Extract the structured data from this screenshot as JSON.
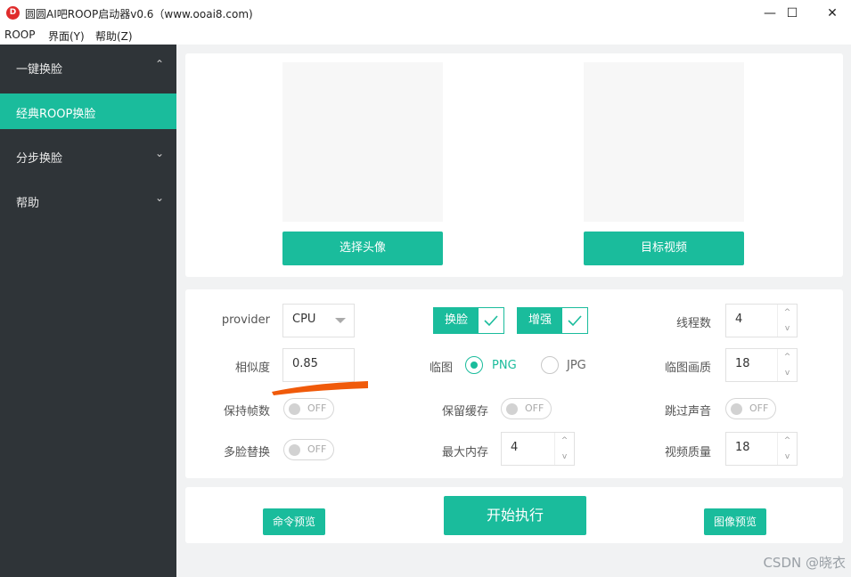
{
  "window": {
    "title": "圆圆AI吧ROOP启动器v0.6（www.ooai8.com)",
    "app_icon_glyph": "D",
    "controls": {
      "minimize": "—",
      "maximize": "☐",
      "close": "✕"
    }
  },
  "menubar": [
    "ROOP",
    "界面(Y)",
    "帮助(Z)"
  ],
  "sidebar": {
    "items": [
      {
        "label": "一键换脸",
        "chevron": "⌃"
      },
      {
        "label": "经典ROOP换脸",
        "chevron": ""
      },
      {
        "label": "分步换脸",
        "chevron": "⌄"
      },
      {
        "label": "帮助",
        "chevron": "⌄"
      }
    ],
    "active_index": 1
  },
  "images": {
    "select_face_button": "选择头像",
    "target_video_button": "目标视频"
  },
  "settings": {
    "provider": {
      "label": "provider",
      "value": "CPU"
    },
    "swap_face": {
      "label": "换脸",
      "checked": true
    },
    "enhance": {
      "label": "增强",
      "checked": true
    },
    "threads": {
      "label": "线程数",
      "value": "4"
    },
    "similarity": {
      "label": "相似度",
      "value": "0.85"
    },
    "temp_frame_format": {
      "label": "临图",
      "options": [
        "PNG",
        "JPG"
      ],
      "selected": "PNG"
    },
    "temp_frame_quality": {
      "label": "临图画质",
      "value": "18"
    },
    "keep_fps": {
      "label": "保持帧数",
      "state": "OFF"
    },
    "keep_temp": {
      "label": "保留缓存",
      "state": "OFF"
    },
    "skip_audio": {
      "label": "跳过声音",
      "state": "OFF"
    },
    "many_faces": {
      "label": "多脸替换",
      "state": "OFF"
    },
    "max_memory": {
      "label": "最大内存",
      "value": "4"
    },
    "video_quality": {
      "label": "视频质量",
      "value": "18"
    }
  },
  "actions": {
    "command_preview": "命令预览",
    "start": "开始执行",
    "image_preview": "图像预览"
  },
  "spinner": {
    "up": "^",
    "down": "v"
  },
  "watermark": "CSDN @晓衣",
  "colors": {
    "accent": "#1abc9c",
    "sidebar_bg": "#2f3438",
    "annotation": "#f05a0a"
  }
}
